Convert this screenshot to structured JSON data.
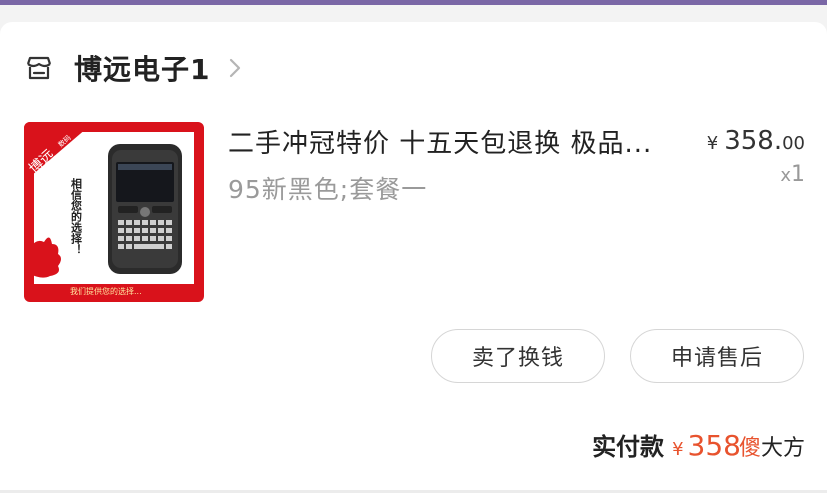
{
  "store": {
    "name": "博远电子1"
  },
  "product": {
    "title": "二手冲冠特价 十五天包退换 极品...",
    "sku": "95新黑色;套餐一",
    "price_currency": "¥",
    "price_integer": "358.",
    "price_decimal": "00",
    "qty_prefix": "x",
    "qty": "1",
    "image": {
      "banner_text": "博远",
      "banner_small": "数码",
      "slogan": "相信您的选择！",
      "footer": "我们提供您的选择..."
    }
  },
  "actions": {
    "sell_label": "卖了换钱",
    "aftersale_label": "申请售后"
  },
  "payment": {
    "label": "实付款",
    "currency": "¥",
    "amount": "358",
    "watermark_1": "傻",
    "watermark_2": "大方"
  },
  "colors": {
    "accent": "#e8532e",
    "top_bar": "#7a67a6",
    "image_red": "#d9121b"
  },
  "icons": {
    "store": "store-icon",
    "chevron": "chevron-right-icon"
  }
}
